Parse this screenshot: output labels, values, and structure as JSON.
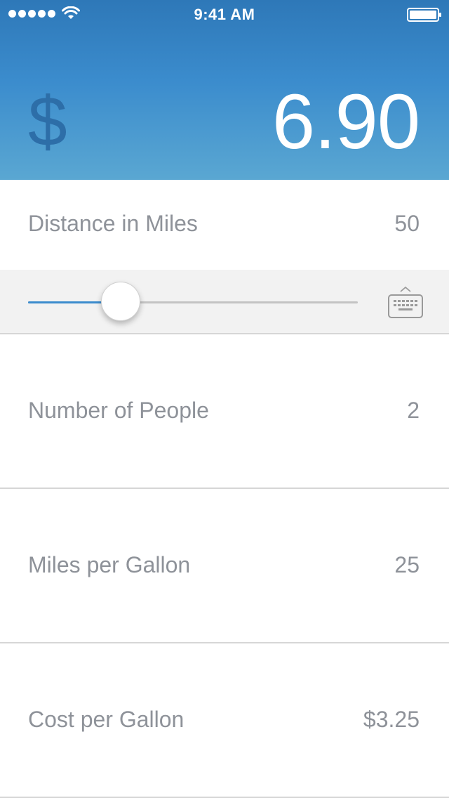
{
  "status_bar": {
    "time": "9:41 AM",
    "signal_icon": "signal-dots-icon",
    "wifi_icon": "wifi-icon",
    "battery_icon": "battery-icon"
  },
  "result": {
    "currency_symbol": "$",
    "total": "6.90"
  },
  "distance": {
    "label": "Distance in Miles",
    "value": "50",
    "slider_level": 0.28
  },
  "slider_panel": {
    "keyboard_icon": "keyboard-icon"
  },
  "fields": {
    "people": {
      "label": "Number of People",
      "value": "2"
    },
    "mpg": {
      "label": "Miles per Gallon",
      "value": "25"
    },
    "cost": {
      "label": "Cost per Gallon",
      "value": "$3.25"
    }
  },
  "colors": {
    "header_top": "#2e78b8",
    "header_bottom": "#5aa7d2",
    "accent": "#3b8ccd",
    "currency_symbol": "#2d6ea8",
    "label_text": "#8e9299"
  }
}
